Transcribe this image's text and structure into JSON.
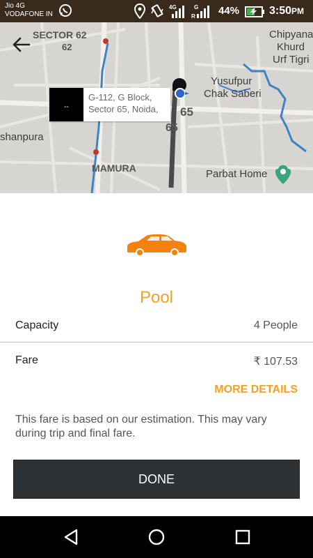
{
  "status_bar": {
    "carrier_line1": "Jio 4G",
    "carrier_line2": "VODAFONE IN",
    "battery": "44%",
    "time": "3:50",
    "time_suffix": "PM",
    "icons": [
      "whatsapp-icon",
      "location-icon",
      "vibrate-icon",
      "signal-4g-icon",
      "signal-g-icon",
      "battery-icon"
    ]
  },
  "map": {
    "labels": {
      "sector62": "SECTOR 62",
      "sector62_num": "62",
      "chipyana1": "Chipyana",
      "chipyana2": "Khurd",
      "chipyana3": "Urf Tigri",
      "yusufpur1": "Yusufpur",
      "yusufpur2": "Chak Saberi",
      "num65a": "65",
      "num65b": "65",
      "shanpura": "shanpura",
      "mamura": "MAMURA",
      "parbat": "Parbat Home"
    },
    "pickup": {
      "eta": "--",
      "address": "G-112, G Block, Sector 65, Noida,"
    }
  },
  "ride": {
    "name": "Pool",
    "capacity_label": "Capacity",
    "capacity_value": "4 People",
    "fare_label": "Fare",
    "fare_value": "₹ 107.53",
    "more_details": "MORE DETAILS",
    "note": "This fare is based on our estimation. This may vary during trip and final fare.",
    "done": "DONE"
  },
  "colors": {
    "accent": "#f5a023",
    "button": "#2f3234",
    "status_bar": "#3a2a1c"
  }
}
